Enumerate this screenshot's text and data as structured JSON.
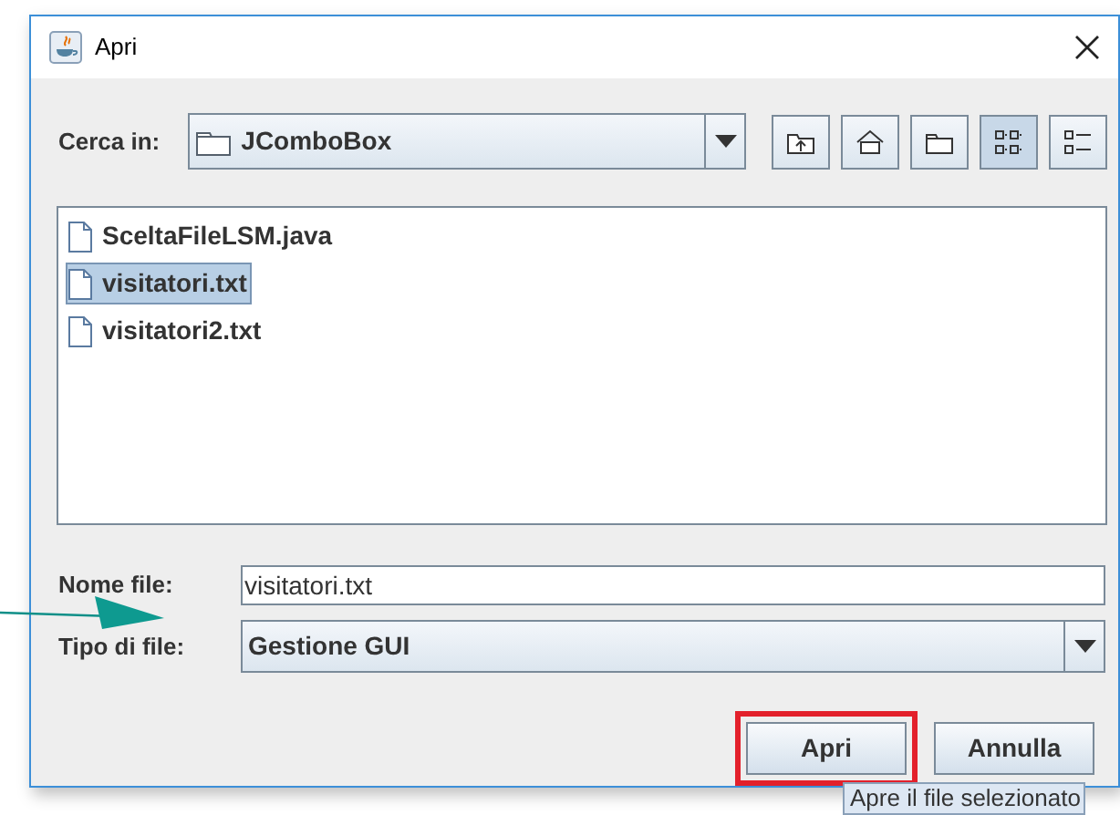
{
  "window": {
    "title": "Apri"
  },
  "look_in": {
    "label": "Cerca in:",
    "value": "JComboBox"
  },
  "toolbar": [
    {
      "kind": "up",
      "selected": false
    },
    {
      "kind": "home",
      "selected": false
    },
    {
      "kind": "new-folder",
      "selected": false
    },
    {
      "kind": "list",
      "selected": true
    },
    {
      "kind": "details",
      "selected": false
    }
  ],
  "files": [
    {
      "name": "SceltaFileLSM.java",
      "selected": false
    },
    {
      "name": "visitatori.txt",
      "selected": true
    },
    {
      "name": "visitatori2.txt",
      "selected": false
    }
  ],
  "file_name": {
    "label": "Nome file:",
    "value": "visitatori.txt"
  },
  "file_type": {
    "label": "Tipo di file:",
    "value": "Gestione GUI"
  },
  "buttons": [
    {
      "label": "Apri",
      "highlighted": true
    },
    {
      "label": "Annulla",
      "highlighted": false
    }
  ],
  "tooltip": "Apre il file selezionato"
}
